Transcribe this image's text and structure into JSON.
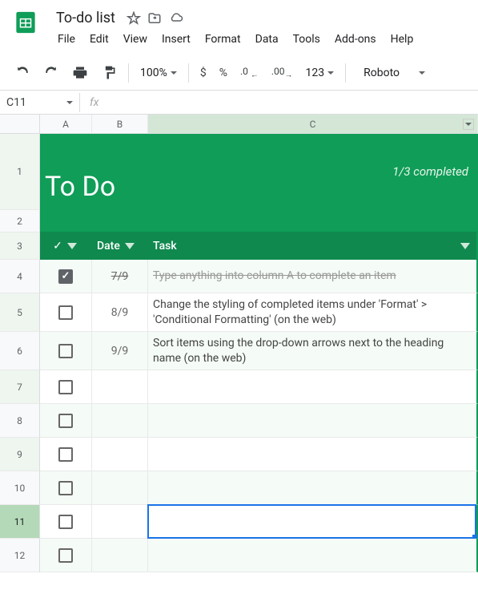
{
  "doc": {
    "title": "To-do list"
  },
  "menu": {
    "file": "File",
    "edit": "Edit",
    "view": "View",
    "insert": "Insert",
    "format": "Format",
    "data": "Data",
    "tools": "Tools",
    "addons": "Add-ons",
    "help": "Help"
  },
  "toolbar": {
    "zoom": "100%",
    "currency": "$",
    "percent": "%",
    "dec_less": ".0",
    "dec_more": ".00",
    "num_fmt": "123",
    "font": "Roboto"
  },
  "namebox": {
    "value": "C11",
    "fx": "fx"
  },
  "cols": {
    "a": "A",
    "b": "B",
    "c": "C"
  },
  "rows": [
    "1",
    "2",
    "3",
    "4",
    "5",
    "6",
    "7",
    "8",
    "9",
    "10",
    "11",
    "12"
  ],
  "tpl": {
    "title": "To Do",
    "subtitle": "1/3 completed",
    "check_hdr": "✓",
    "date_hdr": "Date",
    "task_hdr": "Task",
    "items": [
      {
        "row": 4,
        "checked": true,
        "date": "7/9",
        "task": "Type anything into column A to complete an item"
      },
      {
        "row": 5,
        "checked": false,
        "date": "8/9",
        "task": "Change the styling of completed items under 'Format' > 'Conditional Formatting' (on the web)"
      },
      {
        "row": 6,
        "checked": false,
        "date": "9/9",
        "task": "Sort items using the drop-down arrows next to the heading name (on the web)"
      }
    ]
  },
  "colors": {
    "brand_green": "#0f9d58",
    "sel_blue": "#1a73e8"
  }
}
